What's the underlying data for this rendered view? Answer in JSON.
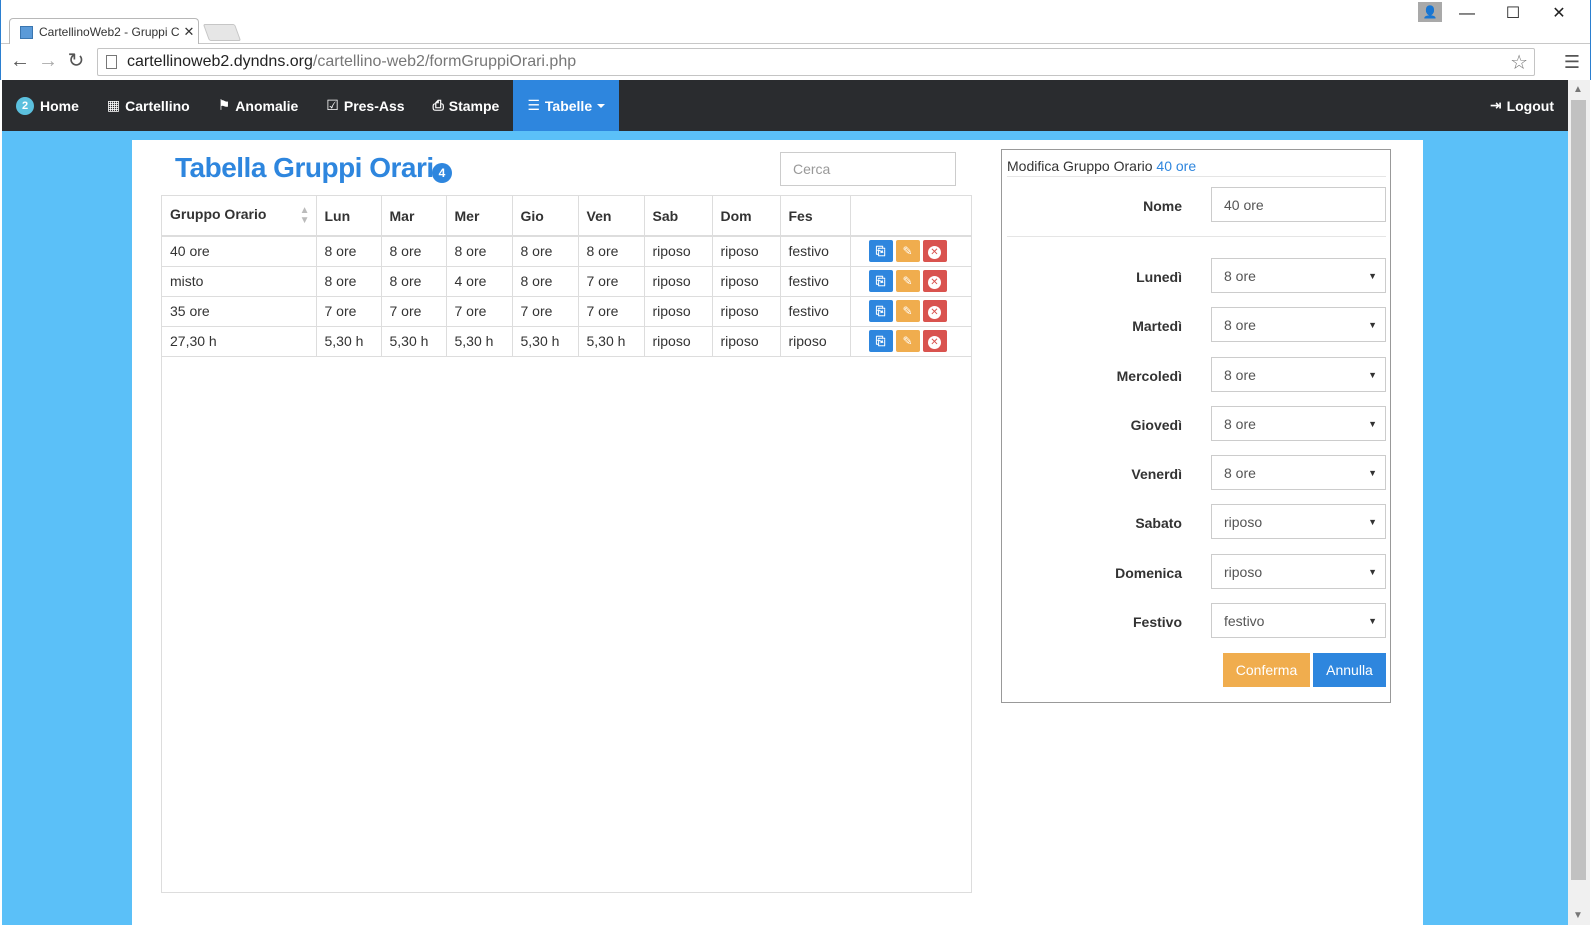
{
  "browser": {
    "tab_title": "CartellinoWeb2 - Gruppi C",
    "url_host": "cartellinoweb2.dyndns.org",
    "url_path": "/cartellino-web2/formGruppiOrari.php"
  },
  "nav": {
    "home_badge": "2",
    "home": "Home",
    "cartellino": "Cartellino",
    "anomalie": "Anomalie",
    "pres_ass": "Pres-Ass",
    "stampe": "Stampe",
    "tabelle": "Tabelle",
    "logout": "Logout"
  },
  "main": {
    "title": "Tabella Gruppi Orari",
    "count_badge": "4",
    "search_placeholder": "Cerca",
    "columns": [
      "Gruppo Orario",
      "Lun",
      "Mar",
      "Mer",
      "Gio",
      "Ven",
      "Sab",
      "Dom",
      "Fes"
    ],
    "rows": [
      [
        "40 ore",
        "8 ore",
        "8 ore",
        "8 ore",
        "8 ore",
        "8 ore",
        "riposo",
        "riposo",
        "festivo"
      ],
      [
        "misto",
        "8 ore",
        "8 ore",
        "4 ore",
        "8 ore",
        "7 ore",
        "riposo",
        "riposo",
        "festivo"
      ],
      [
        "35 ore",
        "7 ore",
        "7 ore",
        "7 ore",
        "7 ore",
        "7 ore",
        "riposo",
        "riposo",
        "festivo"
      ],
      [
        "27,30 h",
        "5,30 h",
        "5,30 h",
        "5,30 h",
        "5,30 h",
        "5,30 h",
        "riposo",
        "riposo",
        "riposo"
      ]
    ]
  },
  "edit": {
    "header_prefix": "Modifica Gruppo Orario",
    "header_value": "40 ore",
    "nome_label": "Nome",
    "nome_value": "40 ore",
    "fields": [
      {
        "label": "Lunedì",
        "value": "8 ore"
      },
      {
        "label": "Martedì",
        "value": "8 ore"
      },
      {
        "label": "Mercoledì",
        "value": "8 ore"
      },
      {
        "label": "Giovedì",
        "value": "8 ore"
      },
      {
        "label": "Venerdì",
        "value": "8 ore"
      },
      {
        "label": "Sabato",
        "value": "riposo"
      },
      {
        "label": "Domenica",
        "value": "riposo"
      },
      {
        "label": "Festivo",
        "value": "festivo"
      }
    ],
    "confirm": "Conferma",
    "cancel": "Annulla"
  },
  "colors": {
    "accent": "#2e86de",
    "page_bg": "#5bc0f8",
    "navbar": "#2a2c2f",
    "warning": "#f0ad4e",
    "danger": "#d9534f"
  }
}
